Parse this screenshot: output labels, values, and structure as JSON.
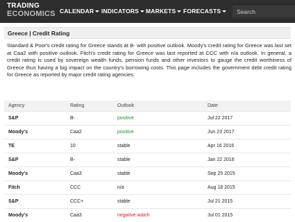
{
  "nav": {
    "logo_line1": "TRADING",
    "logo_line2": "ECONOMICS",
    "items": [
      {
        "label": "CALENDAR"
      },
      {
        "label": "INDICATORS"
      },
      {
        "label": "MARKETS"
      },
      {
        "label": "FORECASTS"
      }
    ],
    "search_placeholder": "Search"
  },
  "page": {
    "title": "Greece | Credit Rating",
    "description": "Standard & Poor's credit rating for Greece stands at B- with positive outlook. Moody's credit rating for Greece was last set at Caa2 with positive outlook. Fitch's credit rating for Greece was last reported at CCC with n/a outlook. In general, a credit rating is used by sovereign wealth funds, pension funds and other investors to gauge the credit worthiness of Greece thus having a big impact on the country's borrowing costs. This page includes the government debt credit rating for Greece as reported by major credit rating agencies."
  },
  "table": {
    "headers": [
      "Agency",
      "Rating",
      "Outlook",
      "Date"
    ],
    "rows": [
      {
        "agency": "S&P",
        "rating": "B-",
        "outlook": "positive",
        "date": "Jul 22 2017"
      },
      {
        "agency": "Moody's",
        "rating": "Caa2",
        "outlook": "positive",
        "date": "Jun 23 2017"
      },
      {
        "agency": "TE",
        "rating": "10",
        "outlook": "stable",
        "date": "Apr 16 2016"
      },
      {
        "agency": "S&P",
        "rating": "B-",
        "outlook": "stable",
        "date": "Jan 22 2016"
      },
      {
        "agency": "Moody's",
        "rating": "Caa3",
        "outlook": "stable",
        "date": "Sep 25 2015"
      },
      {
        "agency": "Fitch",
        "rating": "CCC",
        "outlook": "n/a",
        "date": "Aug 18 2015"
      },
      {
        "agency": "S&P",
        "rating": "CCC+",
        "outlook": "stable",
        "date": "Jul 21 2015"
      },
      {
        "agency": "Moody's",
        "rating": "Caa3",
        "outlook": "negative watch",
        "date": "Jul 01 2015"
      }
    ]
  },
  "colors": {
    "navbar": "#2d2d2d",
    "positive": "#2e8b2e",
    "negative": "#d62020"
  }
}
